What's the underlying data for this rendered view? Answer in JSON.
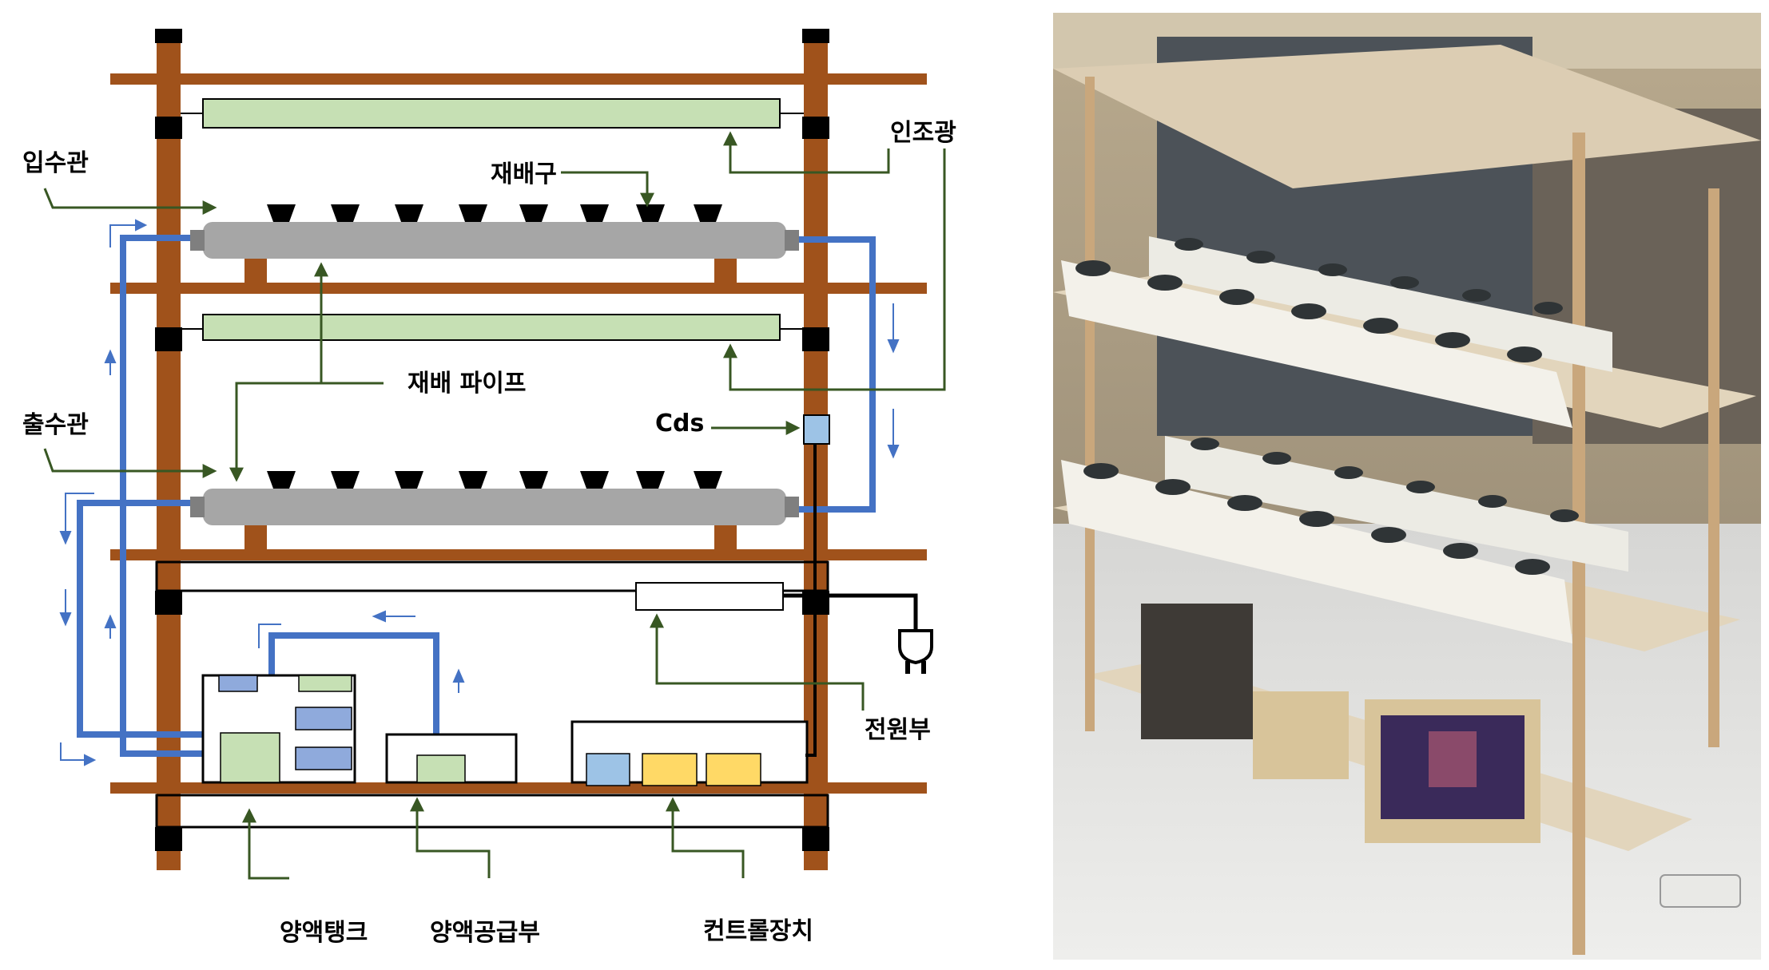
{
  "diagram": {
    "labels": {
      "inlet_pipe": "입수관",
      "outlet_pipe": "출수관",
      "cultivation_cup": "재배구",
      "artificial_light": "인조광",
      "cultivation_pipe": "재배 파이프",
      "cds_sensor": "Cds",
      "power_unit": "전원부",
      "nutrient_tank": "양액탱크",
      "nutrient_supply": "양액공급부",
      "control_device": "컨트롤장치"
    },
    "colors": {
      "frame": "#a0521b",
      "light_fixture": "#c6e0b4",
      "pipe": "#a6a6a6",
      "water_line": "#4472c4",
      "annotation_arrow": "#385723",
      "sensor": "#9dc3e6",
      "module_green": "#c6e0b4",
      "module_blue": "#8faadc",
      "module_yellow": "#ffd966"
    },
    "icons": [
      "power-plug-icon",
      "flow-direction-arrow-icon"
    ]
  }
}
